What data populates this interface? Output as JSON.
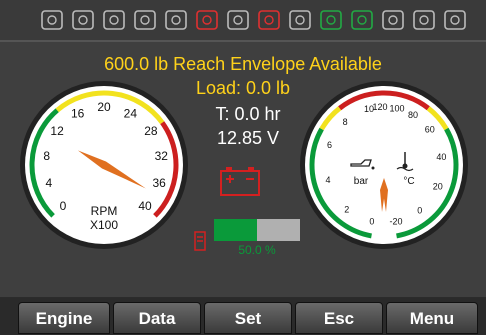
{
  "status_icons": [
    {
      "name": "warning-triangle-icon",
      "color": "#bbbbbb"
    },
    {
      "name": "battery-icon",
      "color": "#bbbbbb"
    },
    {
      "name": "oil-pressure-icon",
      "color": "#bbbbbb"
    },
    {
      "name": "engine-icon",
      "color": "#bbbbbb"
    },
    {
      "name": "glow-plug-icon",
      "color": "#bbbbbb"
    },
    {
      "name": "oil-can-icon",
      "color": "#e03030"
    },
    {
      "name": "brake-icon",
      "color": "#bbbbbb"
    },
    {
      "name": "axle-lock-icon",
      "color": "#e03030"
    },
    {
      "name": "hydraulic-warning-icon",
      "color": "#bbbbbb"
    },
    {
      "name": "turtle-icon",
      "color": "#22aa44"
    },
    {
      "name": "rabbit-icon",
      "color": "#22aa44"
    },
    {
      "name": "max-load-icon",
      "color": "#bbbbbb"
    },
    {
      "name": "filter-icon",
      "color": "#bbbbbb"
    },
    {
      "name": "fuel-icon",
      "color": "#bbbbbb"
    }
  ],
  "header": {
    "envelope_text": "600.0 lb Reach Envelope Available",
    "load_text": "Load: 0.0 lb"
  },
  "stats": {
    "hours": "T: 0.0 hr",
    "voltage": "12.85 V"
  },
  "rpm_gauge": {
    "ticks": [
      "0",
      "4",
      "8",
      "12",
      "16",
      "20",
      "24",
      "28",
      "32",
      "36",
      "40"
    ],
    "label_line1": "RPM",
    "label_line2": "X100",
    "value": 0
  },
  "temp_gauge": {
    "left_ticks": [
      "2",
      "4",
      "6",
      "8",
      "10"
    ],
    "right_ticks": [
      "-20",
      "0",
      "20",
      "40",
      "60",
      "80",
      "100",
      "120"
    ],
    "left_zero": "0",
    "left_unit": "bar",
    "right_unit": "°C"
  },
  "fuel": {
    "level_percent": 50.0,
    "label": "50.0 %"
  },
  "softkeys": [
    "Engine",
    "Data",
    "Set",
    "Esc",
    "Menu"
  ],
  "colors": {
    "accent_yellow": "#ffd21a",
    "green": "#0a9a3a",
    "red": "#cc1f1f",
    "needle": "#e07020"
  }
}
